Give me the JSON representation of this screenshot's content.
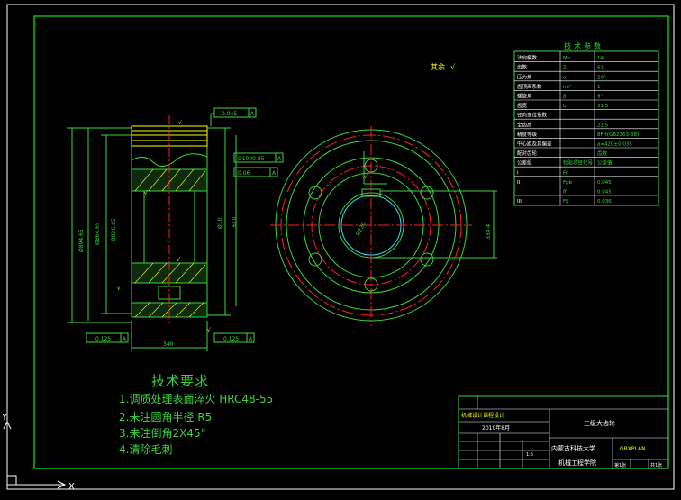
{
  "requirements": {
    "title": "技术要求",
    "items": [
      "1.调质处理表面淬火 HRC48-55",
      "2.未注圆角半径 R5",
      "3.未注倒角2X45°",
      "4.清除毛刺"
    ]
  },
  "params": {
    "title": "技术参数",
    "rows": [
      [
        "法向模数",
        "Mn",
        "14"
      ],
      [
        "齿数",
        "Z",
        "61"
      ],
      [
        "压力角",
        "α",
        "20°"
      ],
      [
        "齿顶高系数",
        "ha*",
        "1"
      ],
      [
        "螺旋角",
        "β",
        "9°"
      ],
      [
        "齿宽",
        "b",
        "31.5"
      ],
      [
        "径向变位系数",
        "",
        ""
      ],
      [
        "全齿高",
        "",
        "22.5"
      ],
      [
        "精度等级",
        "",
        "8FH(GB2363-88)"
      ],
      [
        "中心距及其偏差",
        "",
        "a=420±0.035"
      ],
      [
        "配对齿轮",
        "",
        "齿数"
      ],
      [
        "公差组",
        "检验项目代号",
        "公差值"
      ],
      [
        "I",
        "Fr",
        ""
      ],
      [
        "II",
        "Fpb",
        "0.045"
      ],
      [
        "",
        "ff",
        "0.045"
      ],
      [
        "III",
        "Fβ",
        "0.036"
      ]
    ]
  },
  "title_block": {
    "part_name": "三级大齿轮",
    "school": "内蒙古科技大学",
    "department": "机械工程学院",
    "drawing_no": "GBXPLAN",
    "date": "2010年8月",
    "scale": "1:5",
    "sheet": "第1张",
    "total": "共1张",
    "header": "机械设计课程设计"
  },
  "annotations": {
    "roughness_rest": "其余",
    "flatness": "0.045",
    "runout_a": "0.125",
    "runout_b": "0.125",
    "dia_a": "Ø1000.85",
    "parallel": "0.06",
    "width": "340",
    "dia_left_outer": "Ø894.65",
    "dia_left_mid": "Ø864.65",
    "dia_left_inner": "Ø826.65",
    "dia_right": "Ø10",
    "len_right": "610",
    "keyway": "334.4",
    "bore": "Ø230"
  },
  "colors": {
    "frame": "#ffffff",
    "border": "#19e619",
    "body": "#3cd33c",
    "dim": "#3cd33c",
    "centerline": "#ff2020",
    "cyan": "#22e0ff",
    "yellow": "#ffff00",
    "text": "#3cd33c"
  }
}
